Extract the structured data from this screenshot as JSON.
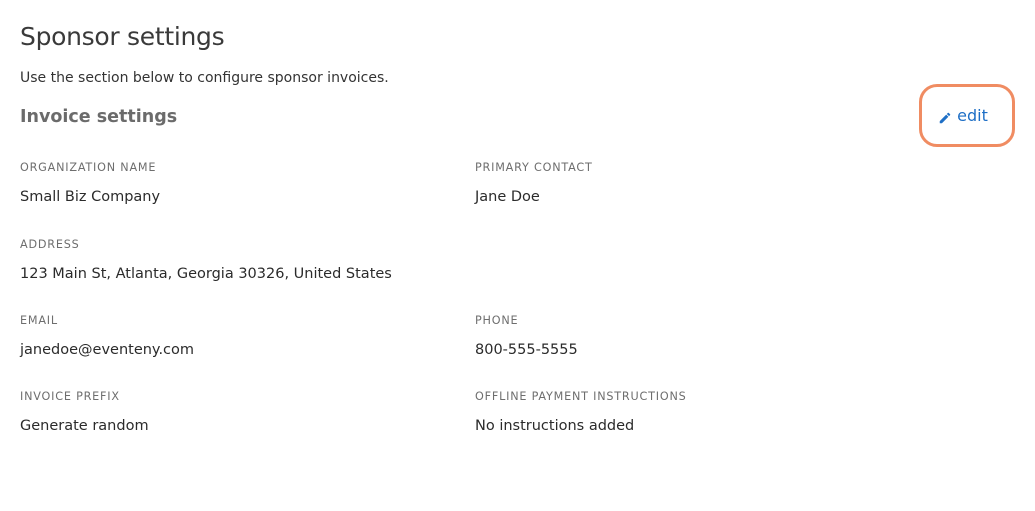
{
  "page": {
    "title": "Sponsor settings",
    "subtitle": "Use the section below to configure sponsor invoices."
  },
  "invoice_settings": {
    "section_title": "Invoice settings",
    "edit_label": "edit",
    "edit_icon": "pencil-icon",
    "accent_color": "#1e6fc6",
    "highlight_color": "#f08c62",
    "fields": {
      "organization_name": {
        "label": "ORGANIZATION NAME",
        "value": "Small Biz Company"
      },
      "primary_contact": {
        "label": "PRIMARY CONTACT",
        "value": "Jane Doe"
      },
      "address": {
        "label": "ADDRESS",
        "value": "123 Main St, Atlanta, Georgia 30326, United States"
      },
      "email": {
        "label": "EMAIL",
        "value": "janedoe@eventeny.com"
      },
      "phone": {
        "label": "PHONE",
        "value": "800-555-5555"
      },
      "invoice_prefix": {
        "label": "INVOICE PREFIX",
        "value": "Generate random"
      },
      "offline_payment_instructions": {
        "label": "OFFLINE PAYMENT INSTRUCTIONS",
        "value": "No instructions added"
      }
    }
  }
}
